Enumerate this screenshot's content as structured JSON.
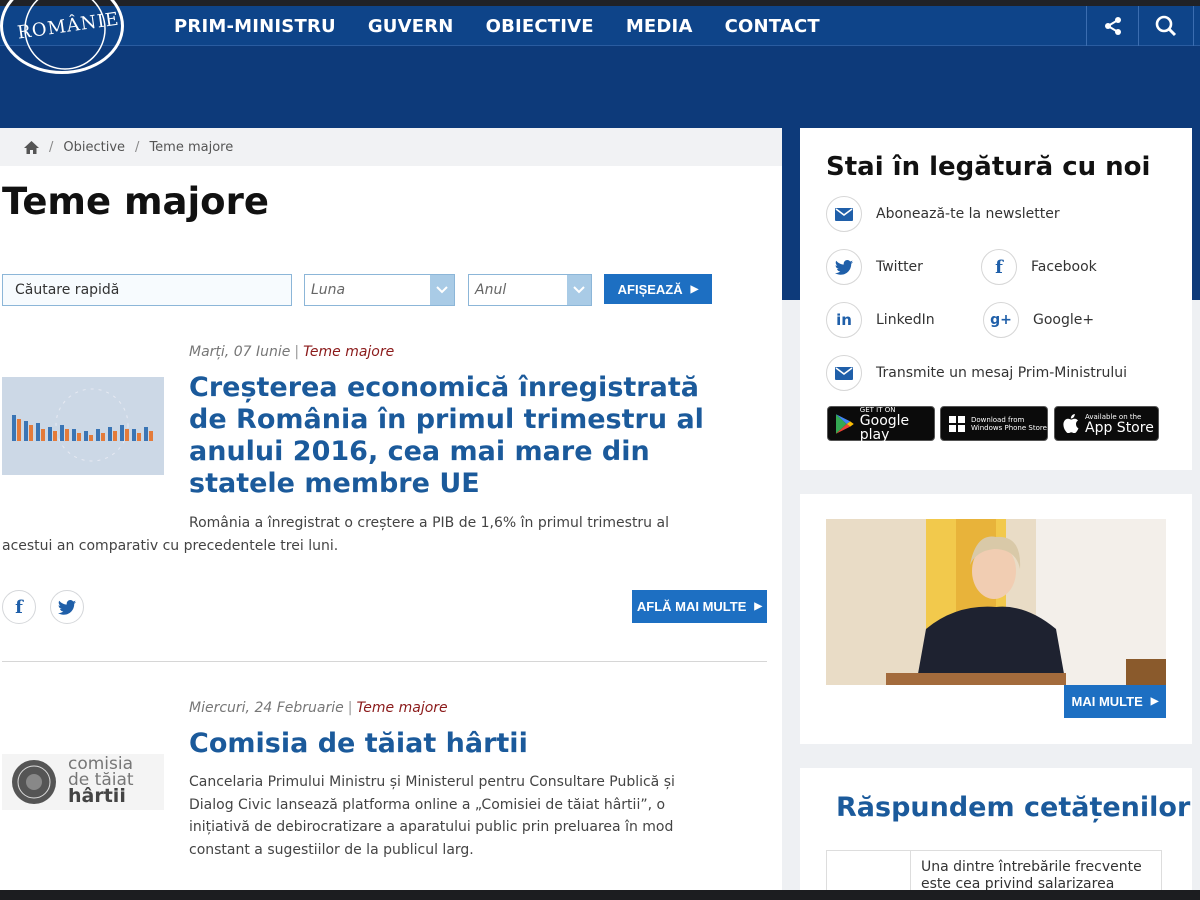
{
  "header": {
    "logo_text": "ROMÂNIEI",
    "nav": [
      "PRIM-MINISTRU",
      "GUVERN",
      "OBIECTIVE",
      "MEDIA",
      "CONTACT"
    ],
    "share_icon": "share-icon",
    "search_icon": "search-icon"
  },
  "breadcrumb": {
    "home_icon": "home-icon",
    "level1": "Obiective",
    "level2": "Teme majore",
    "separator": "/"
  },
  "page": {
    "title": "Teme majore"
  },
  "filters": {
    "search_value": "Căutare rapidă",
    "month_selected": "Luna",
    "year_selected": "Anul",
    "submit_label": "AFIȘEAZĂ"
  },
  "articles": [
    {
      "date": "Marți, 07 Iunie",
      "category": "Teme majore",
      "title": "Creșterea economică înregistrată de România în primul trimestru al anului 2016, cea mai mare din statele membre UE",
      "text_line1": "România a înregistrat o creștere a PIB de 1,6% în primul trimestru al",
      "text_line2": "acestui an comparativ cu precedentele trei luni.",
      "more_label": "AFLĂ MAI MULTE"
    },
    {
      "date": "Miercuri, 24 Februarie",
      "category": "Teme majore",
      "title": "Comisia de tăiat hârtii",
      "thumb_text1": "comisia",
      "thumb_text2": "de tăiat",
      "thumb_text3": "hârtii",
      "text": "Cancelaria Primului Ministru și Ministerul pentru Consultare Publică și Dialog Civic lansează platforma online a „Comisiei de tăiat hârtii”, o inițiativă de debirocratizare a aparatului public prin preluarea în mod constant a sugestiilor de la publicul larg."
    }
  ],
  "sidebar": {
    "contact_title": "Stai în legătură cu noi",
    "newsletter": "Abonează-te la newsletter",
    "twitter": "Twitter",
    "facebook": "Facebook",
    "linkedin": "LinkedIn",
    "googleplus": "Google+",
    "message": "Transmite un mesaj Prim-Ministrului",
    "stores": {
      "google_small": "GET IT ON",
      "google_big": "Google play",
      "windows_small1": "Download from",
      "windows_small2": "Windows Phone Store",
      "apple_small": "Available on the",
      "apple_big": "App Store"
    },
    "more_label": "MAI MULTE",
    "answers_title": "Răspundem cetățenilor",
    "faq_line1": "Una dintre întrebările frecvente",
    "faq_line2": "este cea privind salarizarea"
  },
  "colors": {
    "nav_blue": "#0e4489",
    "accent_blue": "#1d6fc2",
    "title_blue": "#1b5a9b",
    "category_red": "#8b1a1a"
  }
}
